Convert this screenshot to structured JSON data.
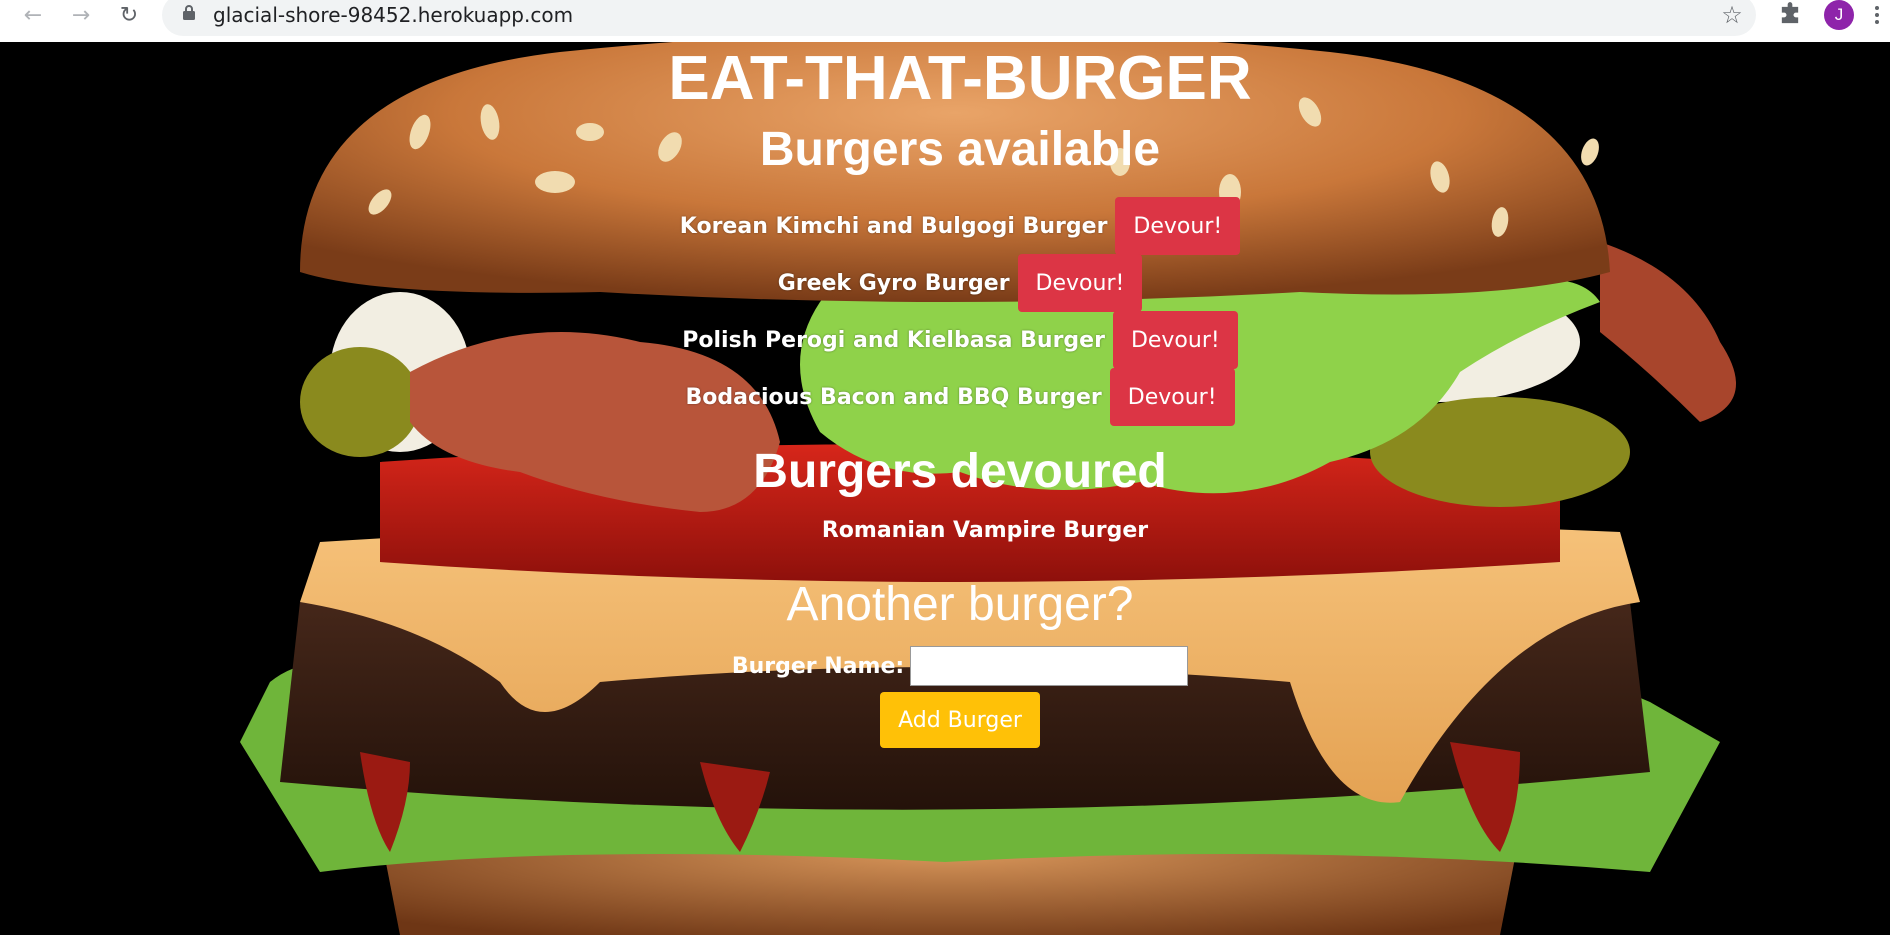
{
  "browser": {
    "url": "glacial-shore-98452.herokuapp.com",
    "avatar_initial": "J",
    "icons": {
      "back": "back-arrow-icon",
      "forward": "forward-arrow-icon",
      "reload": "reload-icon",
      "lock": "lock-icon",
      "bookmark": "star-icon",
      "extensions": "puzzle-icon",
      "menu": "kebab-menu-icon"
    }
  },
  "app": {
    "title": "EAT-THAT-BURGER",
    "available_heading": "Burgers available",
    "available": [
      {
        "name": "Korean Kimchi and Bulgogi Burger",
        "button": "Devour!"
      },
      {
        "name": "Greek Gyro Burger",
        "button": "Devour!"
      },
      {
        "name": "Polish Perogi and Kielbasa Burger",
        "button": "Devour!"
      },
      {
        "name": "Bodacious Bacon and BBQ Burger",
        "button": "Devour!"
      }
    ],
    "devoured_heading": "Burgers devoured",
    "devoured": [
      "Romanian Vampire Burger"
    ],
    "form_heading": "Another burger?",
    "form_label": "Burger Name:",
    "form_value": "",
    "add_button": "Add Burger"
  },
  "colors": {
    "devour_button": "#dc3545",
    "add_button": "#ffc107",
    "avatar": "#8e24aa"
  }
}
